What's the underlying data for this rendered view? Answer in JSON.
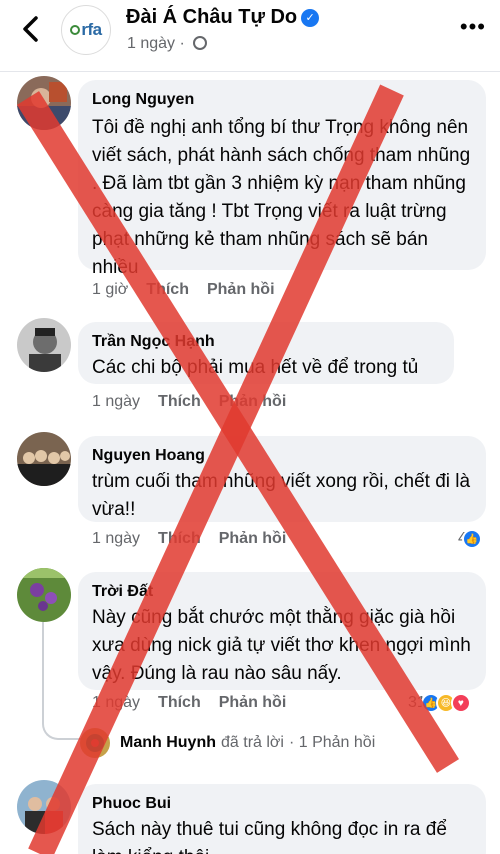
{
  "header": {
    "back_icon": "chevron-left-icon",
    "page_avatar_text": "rfa",
    "page_name": "Đài Á Châu Tự Do",
    "verified_icon": "verified-badge-icon",
    "time": "1 ngày",
    "audience_icon": "globe-icon",
    "more_icon": "more-icon",
    "more_label": "•••"
  },
  "comments": [
    {
      "author": "Long Nguyen",
      "text": "Tôi đề nghị anh tổng bí thư Trọng không nên viết sách, phát hành sách chống tham nhũng . Đã làm tbt gần 3 nhiệm kỳ nạn tham nhũng càng gia tăng ! Tbt Trọng viết ra luật trừng phạt những kẻ tham nhũng sách sẽ bán nhiều",
      "time": "1 giờ",
      "like": "Thích",
      "reply": "Phản hồi"
    },
    {
      "author": "Trần Ngọc Hạnh",
      "text": "Các chi bộ phải mua hết về để trong tủ",
      "time": "1 ngày",
      "like": "Thích",
      "reply": "Phản hồi"
    },
    {
      "author": "Nguyen Hoang",
      "text": "trùm cuối tham nhũng viết xong rồi, chết đi là vừa!!",
      "time": "1 ngày",
      "like": "Thích",
      "reply": "Phản hồi",
      "reaction_count": "4"
    },
    {
      "author": "Trời Đất",
      "text": "Này cũng bắt chước một thằng giặc già hồi xưa dùng nick giả tự viết thơ khen ngợi mình vậy. Đúng là rau nào sâu nấy.",
      "time": "1 ngày",
      "like": "Thích",
      "reply": "Phản hồi",
      "reaction_count": "31"
    },
    {
      "author": "Phuoc Bui",
      "text": "Sách này thuê tui cũng không đọc in ra để làm kiểng thôi"
    }
  ],
  "reply_summary": {
    "name": "Manh Huynh",
    "action": "đã trả lời",
    "count": "· 1 Phản hồi"
  },
  "colors": {
    "x_mark": "#e03a2f",
    "bubble": "#f0f2f5",
    "link_blue": "#1877f2"
  }
}
